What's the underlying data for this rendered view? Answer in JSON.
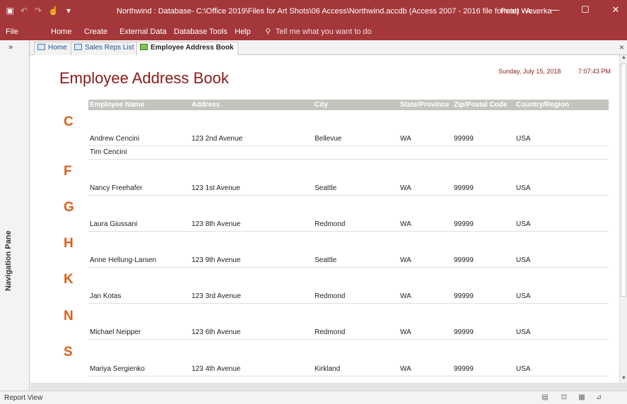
{
  "window": {
    "title": "Northwind : Database- C:\\Office 2019\\Files for Art Shots\\06 Access\\Northwind.accdb (Access 2007 - 2016 file format) - A...",
    "user": "Peter Weverka",
    "minimize_glyph": "—",
    "maximize_glyph": "☐",
    "close_glyph": "✕"
  },
  "quick_access": {
    "save_icon_glyph": "▣",
    "undo_glyph": "↶",
    "redo_glyph": "↷",
    "touch_glyph": "☝",
    "customize_glyph": "▾"
  },
  "ribbon": {
    "tabs": [
      "File",
      "Home",
      "Create",
      "External Data",
      "Database Tools",
      "Help"
    ],
    "tell_me": "Tell me what you want to do",
    "tell_me_icon": "⚲"
  },
  "nav_pane": {
    "label": "Navigation Pane",
    "toggle_glyph": "»"
  },
  "doc_tabs": [
    {
      "label": "Home",
      "active": false
    },
    {
      "label": "Sales Reps List",
      "active": false
    },
    {
      "label": "Employee Address Book",
      "active": true
    }
  ],
  "doc_close_glyph": "×",
  "report": {
    "title": "Employee Address Book",
    "date": "Sunday, July 15, 2018",
    "time": "7:07:43 PM",
    "columns": [
      "Employee Name",
      "Address",
      "City",
      "State/Province",
      "Zip/Postal Code",
      "Country/Region"
    ],
    "groups": [
      {
        "letter": "C",
        "rows": [
          [
            "Andrew Cencini",
            "123 2nd Avenue",
            "Bellevue",
            "WA",
            "99999",
            "USA"
          ],
          [
            "Tim Cencini",
            "",
            "",
            "",
            "",
            ""
          ]
        ]
      },
      {
        "letter": "F",
        "rows": [
          [
            "Nancy Freehafer",
            "123 1st Avenue",
            "Seattle",
            "WA",
            "99999",
            "USA"
          ]
        ]
      },
      {
        "letter": "G",
        "rows": [
          [
            "Laura Giussani",
            "123 8th Avenue",
            "Redmond",
            "WA",
            "99999",
            "USA"
          ]
        ]
      },
      {
        "letter": "H",
        "rows": [
          [
            "Anne Hellung-Larsen",
            "123 9th Avenue",
            "Seattle",
            "WA",
            "99999",
            "USA"
          ]
        ]
      },
      {
        "letter": "K",
        "rows": [
          [
            "Jan Kotas",
            "123 3rd Avenue",
            "Redmond",
            "WA",
            "99999",
            "USA"
          ]
        ]
      },
      {
        "letter": "N",
        "rows": [
          [
            "Michael Neipper",
            "123 6th Avenue",
            "Redmond",
            "WA",
            "99999",
            "USA"
          ]
        ]
      },
      {
        "letter": "S",
        "rows": [
          [
            "Mariya Sergienko",
            "123 4th Avenue",
            "Kirkland",
            "WA",
            "99999",
            "USA"
          ]
        ]
      }
    ]
  },
  "scrollbar": {
    "up_glyph": "▲",
    "down_glyph": "▼"
  },
  "status_bar": {
    "text": "Report View",
    "view_buttons": [
      {
        "name": "report-view-icon",
        "glyph": "▤"
      },
      {
        "name": "print-preview-icon",
        "glyph": "⊡"
      },
      {
        "name": "layout-view-icon",
        "glyph": "▦"
      },
      {
        "name": "design-view-icon",
        "glyph": "⊿"
      }
    ]
  },
  "colors": {
    "accent": "#a4373a",
    "report_title": "#8b1a1a",
    "group_letter": "#d9601e",
    "header_band": "#c4c4bf"
  }
}
